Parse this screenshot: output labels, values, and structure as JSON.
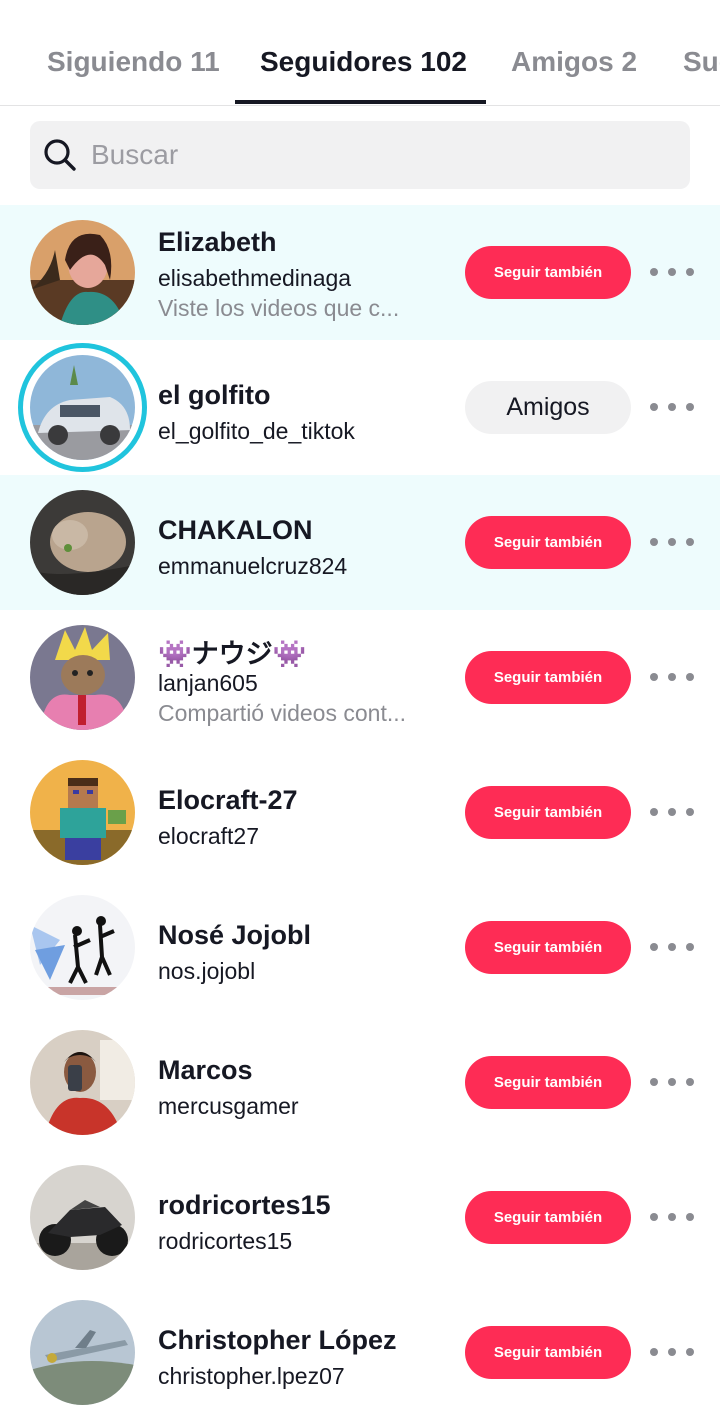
{
  "tabs": [
    {
      "label": "Siguiendo 11"
    },
    {
      "label": "Seguidores 102"
    },
    {
      "label": "Amigos 2"
    },
    {
      "label": "Sug"
    }
  ],
  "active_tab": "Seguidores 102",
  "search": {
    "placeholder": "Buscar",
    "value": ""
  },
  "followers": [
    {
      "name": "Elizabeth",
      "handle": "elisabethmedinaga",
      "subtitle": "Viste los videos que c...",
      "button": "Seguir también",
      "highlighted": true
    },
    {
      "name": "el golfito",
      "handle": "el_golfito_de_tiktok",
      "subtitle": "",
      "button": "Amigos",
      "highlighted": false
    },
    {
      "name": "CHAKALON",
      "handle": "emmanuelcruz824",
      "subtitle": "",
      "button": "Seguir también",
      "highlighted": true
    },
    {
      "name": "👾ナウジ👾",
      "handle": "lanjan605",
      "subtitle": "Compartió videos cont...",
      "button": "Seguir también",
      "highlighted": false
    },
    {
      "name": "Elocraft-27",
      "handle": "elocraft27",
      "subtitle": "",
      "button": "Seguir también",
      "highlighted": false
    },
    {
      "name": "Nosé Jojobl",
      "handle": "nos.jojobl",
      "subtitle": "",
      "button": "Seguir también",
      "highlighted": false
    },
    {
      "name": "Marcos",
      "handle": "mercusgamer",
      "subtitle": "",
      "button": "Seguir también",
      "highlighted": false
    },
    {
      "name": "rodricortes15",
      "handle": "rodricortes15",
      "subtitle": "",
      "button": "Seguir también",
      "highlighted": false
    },
    {
      "name": "Christopher López",
      "handle": "christopher.lpez07",
      "subtitle": "",
      "button": "Seguir también",
      "highlighted": false
    }
  ],
  "colors": {
    "accent": "#fe2c55",
    "highlight_row": "#eefcfd",
    "story_ring": "#20c4dd"
  }
}
